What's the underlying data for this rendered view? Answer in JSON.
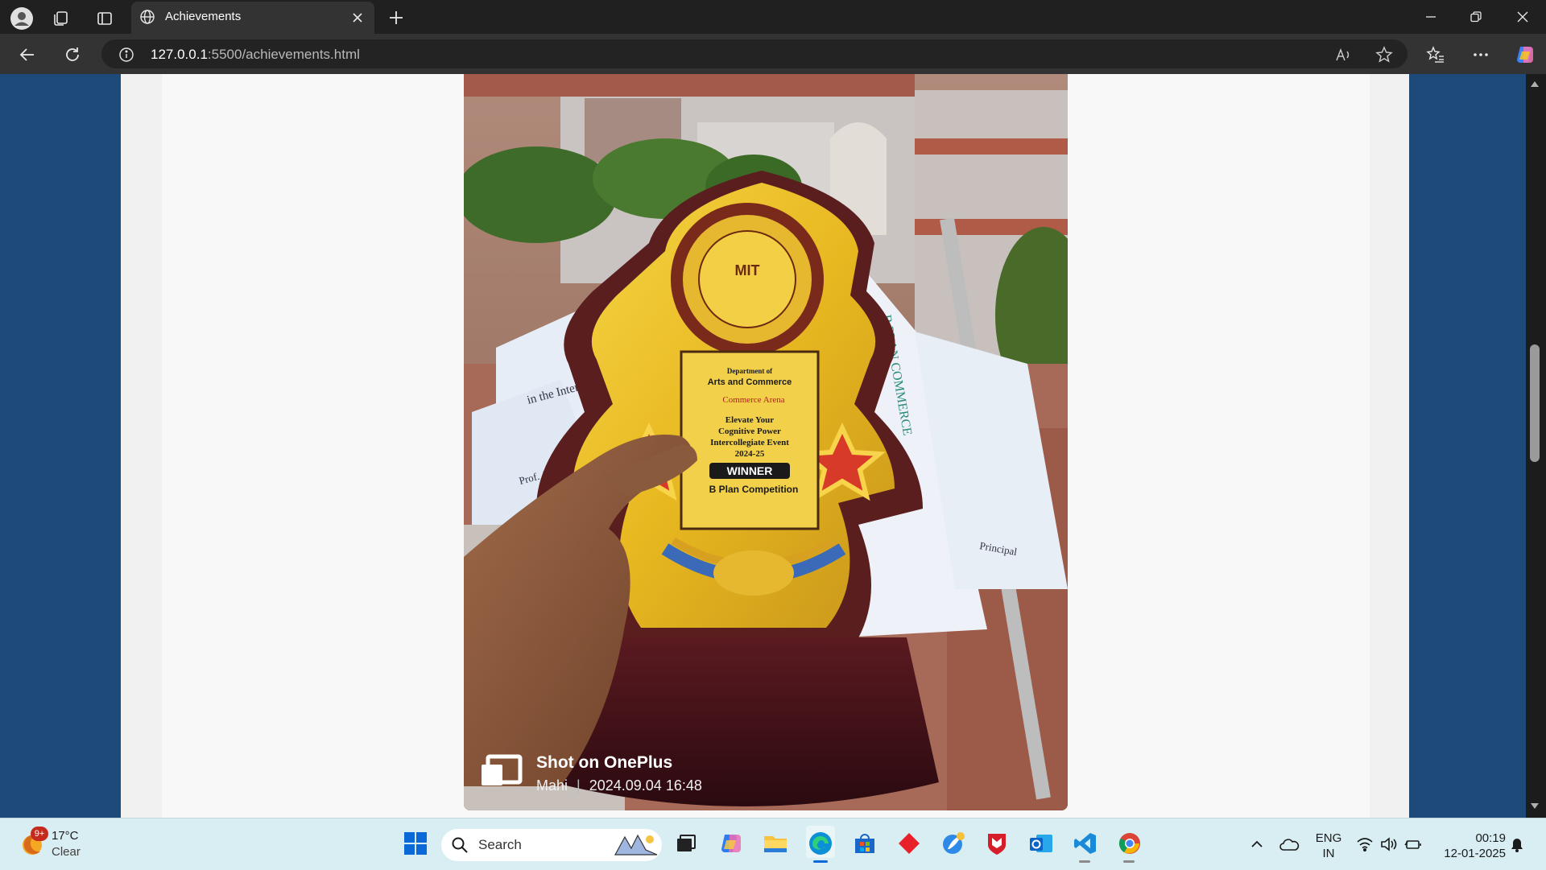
{
  "browser": {
    "tab_title": "Achievements",
    "url_host": "127.0.0.1",
    "url_rest": ":5500/achievements.html"
  },
  "photo": {
    "trophy_text": {
      "dept": "Department of",
      "dept2": "Arts and Commerce",
      "brand": "Commerce Arena",
      "line1": "Elevate Your",
      "line2": "Cognitive Power",
      "line3": "Intercollegiate Event",
      "year": "2024-25",
      "badge": "WINNER",
      "comp": "B Plan Competition",
      "logo": "MIT"
    },
    "watermark_title": "Shot on OnePlus",
    "watermark_author": "Mahi",
    "watermark_datetime": "2024.09.04 16:48"
  },
  "taskbar": {
    "weather_temp": "17°C",
    "weather_cond": "Clear",
    "weather_badge": "9+",
    "search_label": "Search",
    "lang_line1": "ENG",
    "lang_line2": "IN",
    "time": "00:19",
    "date": "12-01-2025"
  }
}
